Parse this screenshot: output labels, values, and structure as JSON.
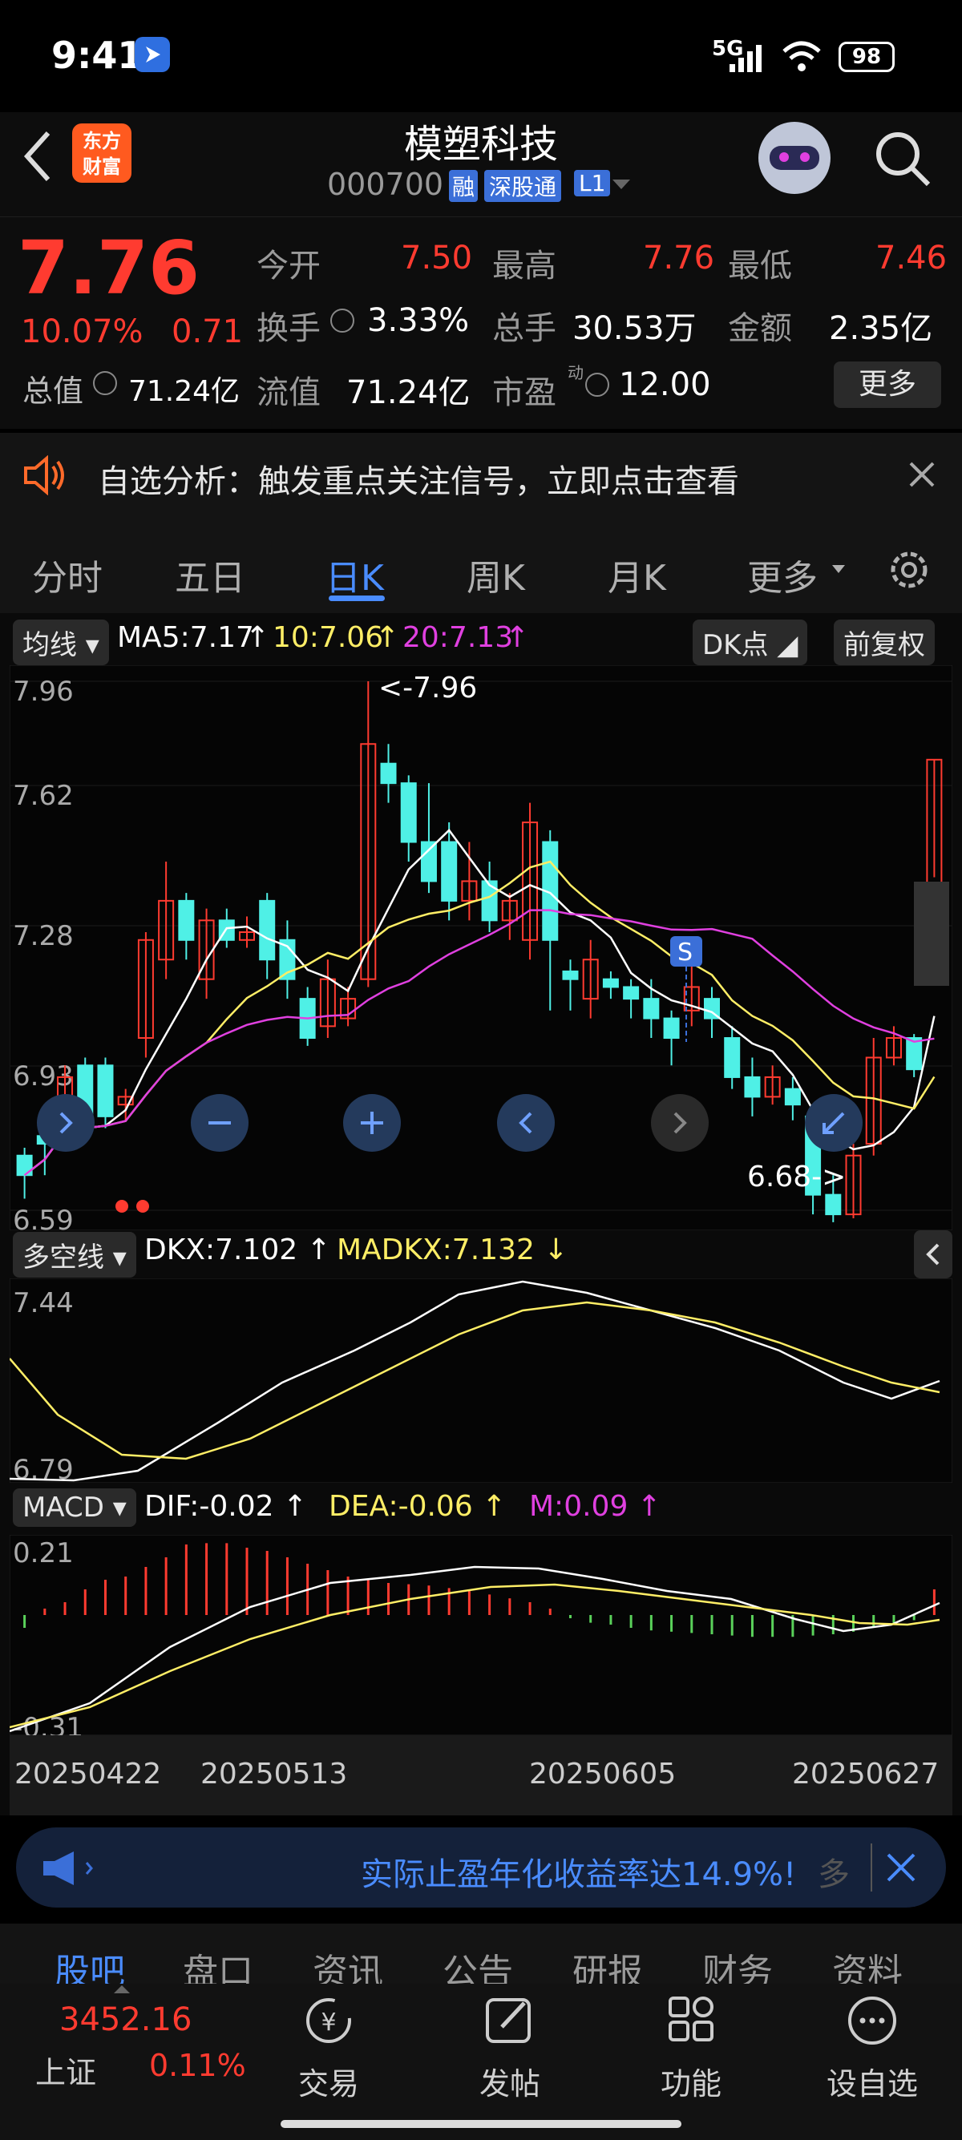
{
  "status_bar": {
    "time": "9:41",
    "network": "5G",
    "battery": "98"
  },
  "header": {
    "logo_line1": "东方",
    "logo_line2": "财富",
    "title": "模塑科技",
    "code": "000700",
    "tag_rong": "融",
    "tag_sgt": "深股通",
    "tag_l1": "L1"
  },
  "quote": {
    "price": "7.76",
    "change_pct": "10.07%",
    "change": "0.71",
    "open_label": "今开",
    "open": "7.50",
    "high_label": "最高",
    "high": "7.76",
    "low_label": "最低",
    "low": "7.46",
    "turnover_label": "换手",
    "turnover": "3.33%",
    "volume_label": "总手",
    "volume": "30.53万",
    "amount_label": "金额",
    "amount": "2.35亿",
    "mcap_label": "总值",
    "mcap": "71.24亿",
    "float_label": "流值",
    "float": "71.24亿",
    "pe_label": "市盈",
    "pe_sup": "动",
    "pe": "12.00",
    "more": "更多"
  },
  "banner": {
    "text": "自选分析：触发重点关注信号，立即点击查看"
  },
  "tabs": [
    "分时",
    "五日",
    "日K",
    "周K",
    "月K",
    "更多"
  ],
  "kchart": {
    "indicator": "均线",
    "ma5": "MA5:7.17",
    "ma10": "10:7.06",
    "ma20": "20:7.13",
    "dk": "DK点",
    "adjust": "前复权",
    "y_labels": [
      "7.96",
      "7.62",
      "7.28",
      "6.93",
      "6.59"
    ],
    "max_note": "<-7.96",
    "min_note": "6.68->",
    "s_marker": "S",
    "colors": {
      "up": "#ff3b30",
      "down": "#4ff0e6",
      "ma5": "#ffffff",
      "ma10": "#ffee66",
      "ma20": "#e040e0"
    }
  },
  "dkx": {
    "label": "多空线",
    "dkx": "DKX:7.102",
    "madkx": "MADKX:7.132",
    "y_labels": [
      "7.44",
      "6.79"
    ]
  },
  "macd": {
    "label": "MACD",
    "dif": "DIF:-0.02",
    "dea": "DEA:-0.06",
    "m": "M:0.09",
    "y_labels": [
      "0.21",
      "-0.31"
    ]
  },
  "dates": [
    "20250422",
    "20250513",
    "20250605",
    "20250627"
  ],
  "promo": {
    "text": "实际止盈年化收益率达14.9%!",
    "more": "多"
  },
  "bottom_tabs": [
    "股吧",
    "盘口",
    "资讯",
    "公告",
    "研报",
    "财务",
    "资料"
  ],
  "index": {
    "value": "3452.16",
    "name": "上证",
    "pct": "0.11%"
  },
  "nav": [
    "交易",
    "发帖",
    "功能",
    "设自选"
  ]
}
